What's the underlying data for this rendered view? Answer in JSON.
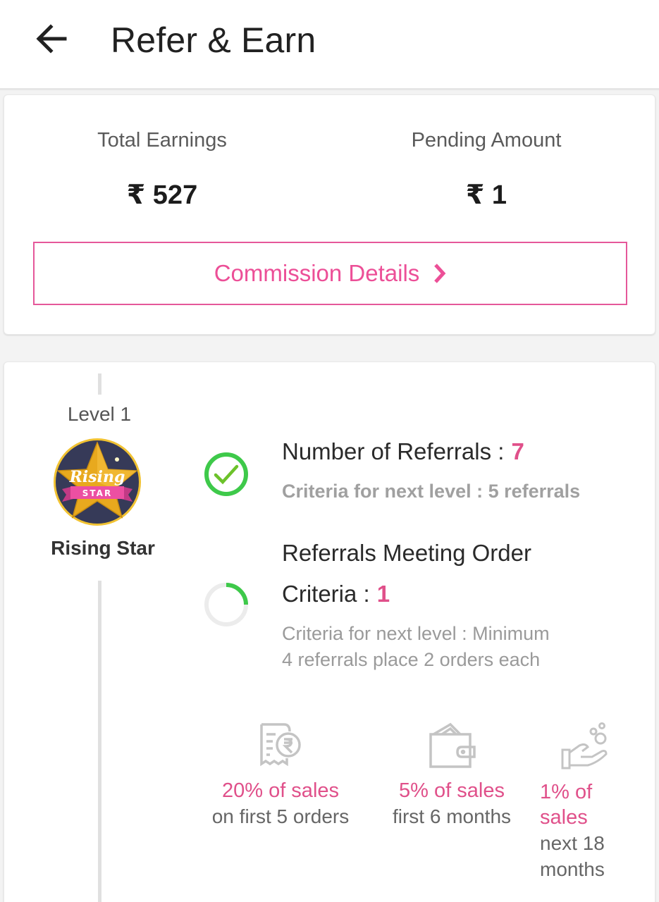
{
  "header": {
    "title": "Refer & Earn",
    "back_icon": "arrow-left-icon"
  },
  "earnings": {
    "total_label": "Total Earnings",
    "total_value": "₹ 527",
    "pending_label": "Pending Amount",
    "pending_value": "₹ 1",
    "commission_button": "Commission Details",
    "commission_icon": "chevron-right-icon"
  },
  "colors": {
    "accent_pink": "#e0508a",
    "success_green": "#3ec94a",
    "muted_gray": "#9a9a9a"
  },
  "level": {
    "label": "Level 1",
    "name": "Rising Star",
    "badge_text_top": "Rising",
    "badge_text_bottom": "STAR"
  },
  "criteria": [
    {
      "status": "complete",
      "icon": "check-circle-icon",
      "title": "Number of Referrals :",
      "value": "7",
      "sub": "Criteria for next level : 5 referrals"
    },
    {
      "status": "in-progress",
      "icon": "progress-ring-icon",
      "progress_fraction": 0.25,
      "title_line1": "Referrals Meeting Order",
      "title_line2": "Criteria :",
      "value": "1",
      "sub_line1": "Criteria for next level : Minimum",
      "sub_line2": "4 referrals place 2 orders each"
    }
  ],
  "benefits": [
    {
      "icon": "receipt-rupee-icon",
      "pct": "20% of sales",
      "desc": "on first 5 orders"
    },
    {
      "icon": "wallet-icon",
      "pct": "5% of sales",
      "desc": "first 6 months"
    },
    {
      "icon": "hand-coins-icon",
      "pct_line1": "1% of",
      "pct_line2": "sales",
      "desc_line1": "next 18",
      "desc_line2": "months"
    }
  ]
}
